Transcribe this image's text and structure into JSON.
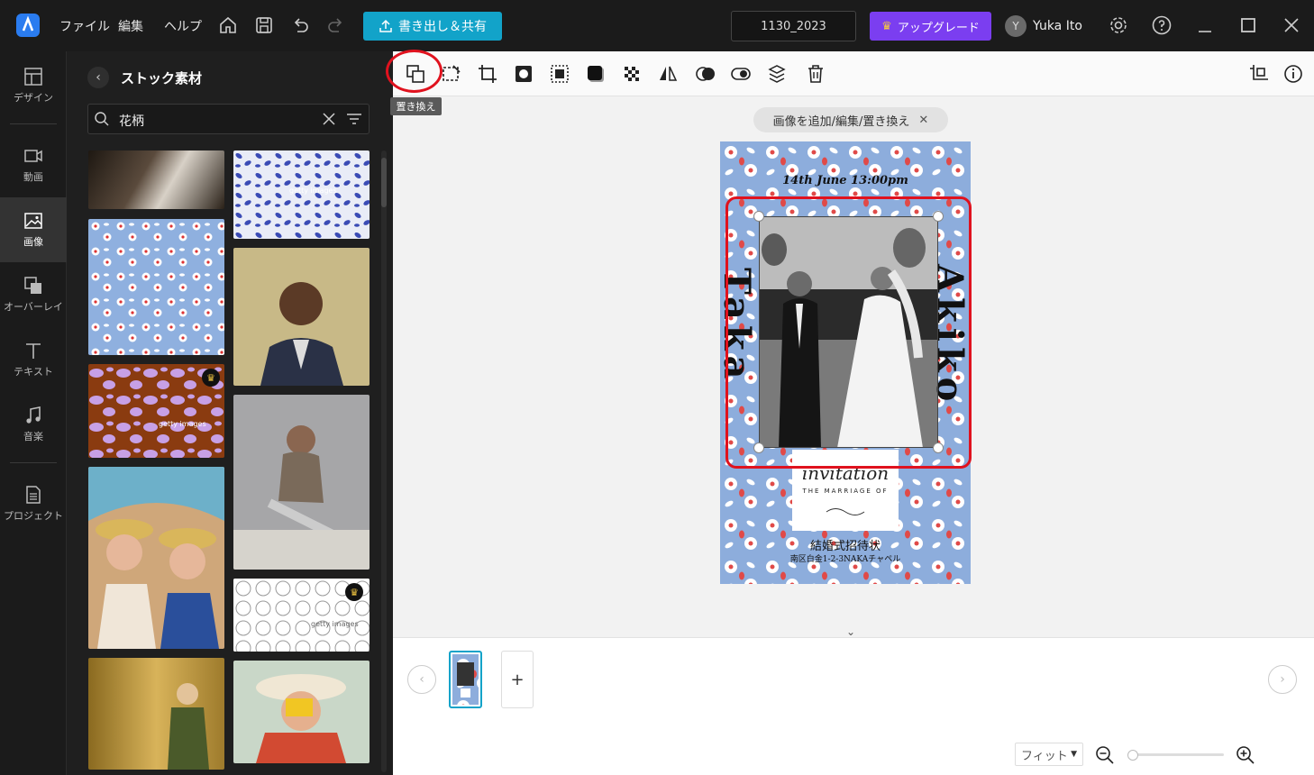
{
  "titlebar": {
    "menus": [
      "ファイル",
      "編集",
      "ヘルプ"
    ],
    "export_label": "書き出し＆共有",
    "project_name": "1130_2023",
    "upgrade_label": "アップグレード",
    "avatar_initial": "Y",
    "username": "Yuka Ito"
  },
  "rail": {
    "items": [
      {
        "label": "デザイン",
        "icon": "design-icon"
      },
      {
        "label": "動画",
        "icon": "video-icon"
      },
      {
        "label": "画像",
        "icon": "image-icon"
      },
      {
        "label": "オーバーレイ",
        "icon": "overlay-icon"
      },
      {
        "label": "テキスト",
        "icon": "text-icon"
      },
      {
        "label": "音楽",
        "icon": "music-icon"
      },
      {
        "label": "プロジェクト",
        "icon": "project-icon"
      }
    ],
    "active": "画像"
  },
  "panel": {
    "title": "ストック素材",
    "search_value": "花柄",
    "thumbnails": [
      {
        "label": "getty images",
        "premium": false
      },
      {
        "label": "getty images",
        "premium": false
      },
      {
        "label": "",
        "premium": false
      },
      {
        "label": "",
        "premium": false
      },
      {
        "label": "getty images",
        "premium": true
      },
      {
        "label": "",
        "premium": false
      },
      {
        "label": "",
        "premium": false
      },
      {
        "label": "getty images",
        "premium": true
      },
      {
        "label": "",
        "premium": false
      },
      {
        "label": "",
        "premium": false
      }
    ]
  },
  "toolbar": {
    "tooltip": "置き換え",
    "tools": [
      "replace-icon",
      "remove-bg-icon",
      "crop-icon",
      "mask-icon",
      "border-icon",
      "shadow-icon",
      "transparency-icon",
      "flip-icon",
      "blend-icon",
      "adjust-icon",
      "layer-icon",
      "delete-icon"
    ]
  },
  "canvas": {
    "hint": "画像を追加/編集/置き換え",
    "design": {
      "date_text": "14th June 13:00pm",
      "name_left": "Taka",
      "name_right": "Akiko",
      "invitation_script": "invitation",
      "invitation_sub": "THE MARRIAGE OF",
      "title_jp": "結婚式招待状",
      "address": "南区白金1-2-3NAKAチャペル"
    }
  },
  "bottom": {
    "add_label": "+",
    "zoom_option": "フィット"
  },
  "colors": {
    "accent": "#12a3c9",
    "upgrade": "#7b3ef0",
    "highlight": "#e0121e",
    "pattern_bg": "#8daddc"
  }
}
